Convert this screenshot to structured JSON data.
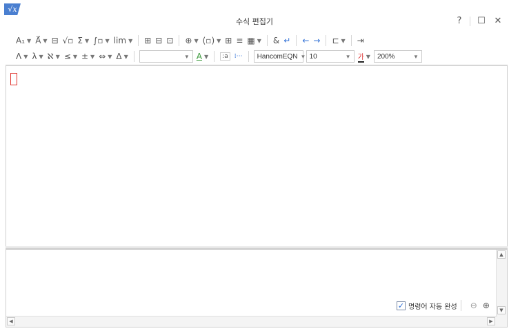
{
  "window": {
    "app_icon": "√x",
    "title": "수식 편집기",
    "help": "?",
    "maximize": "☐",
    "close": "✕"
  },
  "toolbar1": [
    {
      "name": "subscript-tool",
      "glyph": "A₁",
      "dd": true
    },
    {
      "name": "decoration-tool",
      "glyph": "A⃗",
      "dd": true
    },
    {
      "name": "fraction-tool",
      "glyph": "⊟",
      "dd": false
    },
    {
      "name": "root-tool",
      "glyph": "√▫",
      "dd": false
    },
    {
      "name": "sum-tool",
      "glyph": "Σ",
      "dd": true
    },
    {
      "name": "integral-tool",
      "glyph": "∫▫",
      "dd": true
    },
    {
      "name": "limit-tool",
      "glyph": "lim",
      "dd": true
    },
    {
      "sep": true
    },
    {
      "name": "matrix-tool-1",
      "glyph": "⊞",
      "dd": false
    },
    {
      "name": "matrix-tool-2",
      "glyph": "⊟",
      "dd": false
    },
    {
      "name": "matrix-tool-3",
      "glyph": "⊡",
      "dd": false
    },
    {
      "sep": true
    },
    {
      "name": "arrow-box-tool",
      "glyph": "⊕",
      "dd": true
    },
    {
      "name": "paren-tool",
      "glyph": "(▫)",
      "dd": true
    },
    {
      "name": "grid-tool",
      "glyph": "⊞",
      "dd": false
    },
    {
      "name": "align-tool",
      "glyph": "≡",
      "dd": false
    },
    {
      "name": "table-tool",
      "glyph": "▦",
      "dd": true
    },
    {
      "sep": true
    },
    {
      "name": "ampersand-tool",
      "glyph": "&",
      "dd": false
    },
    {
      "name": "newline-tool",
      "glyph": "↵",
      "dd": false,
      "blue": true
    },
    {
      "sep": true
    },
    {
      "name": "arrow-left-tool",
      "glyph": "←",
      "dd": false,
      "blue": true
    },
    {
      "name": "arrow-right-tool",
      "glyph": "→",
      "dd": false,
      "blue": true
    },
    {
      "sep": true
    },
    {
      "name": "insert-tool",
      "glyph": "⊏",
      "dd": true
    },
    {
      "sep": true
    },
    {
      "name": "exit-tool",
      "glyph": "⇥",
      "dd": false
    }
  ],
  "toolbar2": [
    {
      "name": "greek-upper-tool",
      "glyph": "Λ",
      "dd": true
    },
    {
      "name": "greek-lower-tool",
      "glyph": "λ",
      "dd": true
    },
    {
      "name": "hebrew-tool",
      "glyph": "ℵ",
      "dd": true
    },
    {
      "name": "relation-tool",
      "glyph": "≤",
      "dd": true
    },
    {
      "name": "operator-tool",
      "glyph": "±",
      "dd": true
    },
    {
      "name": "arrow-symbol-tool",
      "glyph": "⇔",
      "dd": true
    },
    {
      "name": "misc-symbol-tool",
      "glyph": "Δ",
      "dd": true
    }
  ],
  "toolbar2_right": {
    "style_combo": "",
    "color_tool": "A",
    "font_combo": "HancomEQN",
    "size_combo": "10",
    "text_color_tool": "가",
    "zoom_combo": "200%"
  },
  "script_pane": {
    "autocomplete_label": "명령어 자동 완성",
    "autocomplete_checked": "✓",
    "zoom_out": "⊖",
    "zoom_in": "⊕"
  }
}
